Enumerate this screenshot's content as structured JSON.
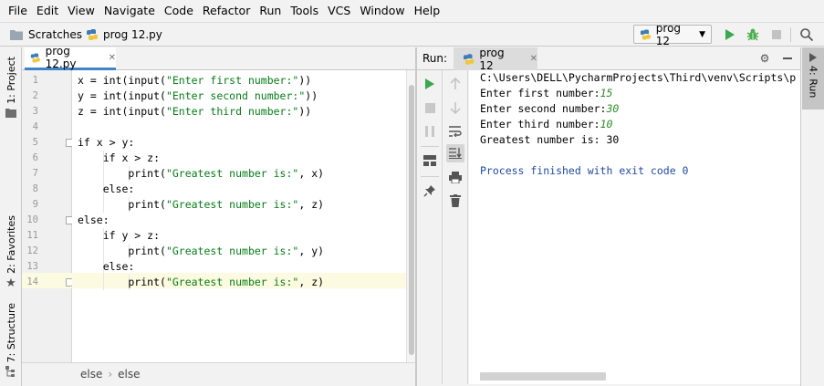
{
  "menubar": {
    "items": [
      {
        "label": "File"
      },
      {
        "label": "Edit"
      },
      {
        "label": "View"
      },
      {
        "label": "Navigate"
      },
      {
        "label": "Code"
      },
      {
        "label": "Refactor"
      },
      {
        "label": "Run"
      },
      {
        "label": "Tools"
      },
      {
        "label": "VCS"
      },
      {
        "label": "Window"
      },
      {
        "label": "Help"
      }
    ]
  },
  "navbar": {
    "scratches_label": "Scratches",
    "file_label": "prog 12.py",
    "run_config_label": "prog 12"
  },
  "left_strip": {
    "project_label": "1: Project",
    "favorites_label": "2: Favorites",
    "structure_label": "7: Structure"
  },
  "right_strip": {
    "run_label": "4: Run"
  },
  "editor": {
    "tab_label": "prog 12.py",
    "lines": [
      {
        "n": "1",
        "code": "x = int(input(\"Enter first number:\"))"
      },
      {
        "n": "2",
        "code": "y = int(input(\"Enter second number:\"))"
      },
      {
        "n": "3",
        "code": "z = int(input(\"Enter third number:\"))"
      },
      {
        "n": "4",
        "code": ""
      },
      {
        "n": "5",
        "code": "if x > y:"
      },
      {
        "n": "6",
        "code": "    if x > z:"
      },
      {
        "n": "7",
        "code": "        print(\"Greatest number is:\", x)"
      },
      {
        "n": "8",
        "code": "    else:"
      },
      {
        "n": "9",
        "code": "        print(\"Greatest number is:\", z)"
      },
      {
        "n": "10",
        "code": "else:"
      },
      {
        "n": "11",
        "code": "    if y > z:"
      },
      {
        "n": "12",
        "code": "        print(\"Greatest number is:\", y)"
      },
      {
        "n": "13",
        "code": "    else:"
      },
      {
        "n": "14",
        "code": "        print(\"Greatest number is:\", z)"
      }
    ],
    "breadcrumb": [
      "else",
      "else"
    ]
  },
  "run_panel": {
    "title": "Run:",
    "tab_label": "prog 12",
    "console": {
      "command": "C:\\Users\\DELL\\PycharmProjects\\Third\\venv\\Scripts\\p",
      "prompt1": "Enter first number:",
      "input1": "15",
      "prompt2": "Enter second number:",
      "input2": "30",
      "prompt3": "Enter third number:",
      "input3": "10",
      "result": "Greatest number is: 30",
      "exit": "Process finished with exit code 0"
    }
  },
  "colors": {
    "run_green": "#3aa84d",
    "debug_green": "#4caf50",
    "string_green": "#067d17",
    "user_input_green": "#2a8c2a",
    "tab_underline": "#4083c9",
    "current_line": "#fcfae1"
  }
}
